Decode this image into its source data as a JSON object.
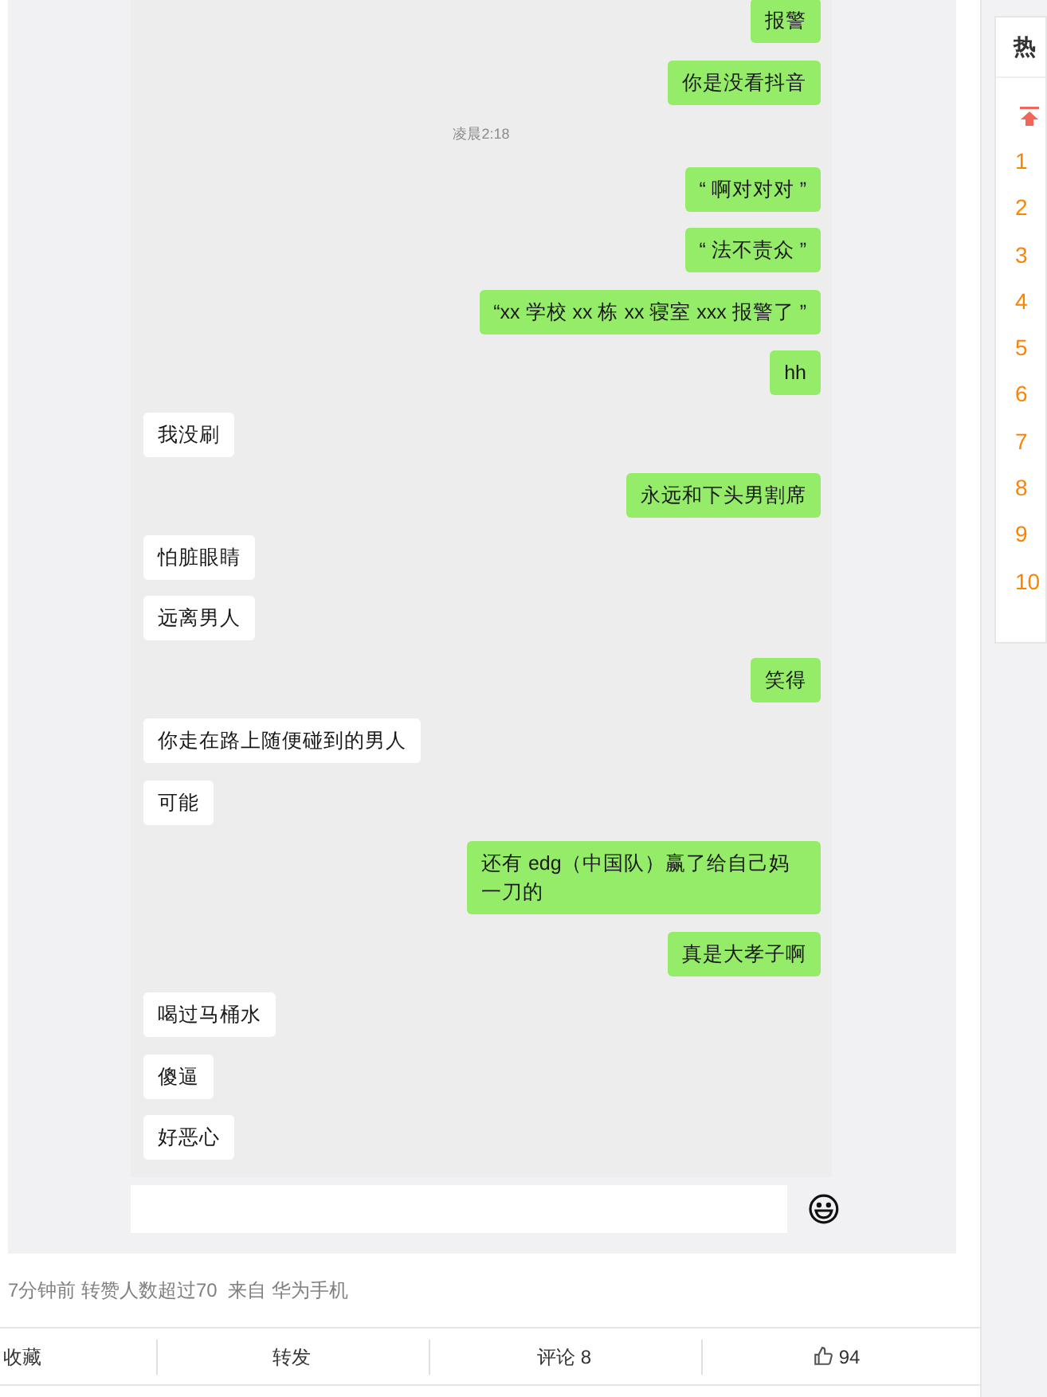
{
  "chat": {
    "messages": [
      {
        "kind": "sent",
        "text": "报警"
      },
      {
        "kind": "sent",
        "text": "你是没看抖音"
      },
      {
        "kind": "time",
        "text": "凌晨2:18"
      },
      {
        "kind": "sent",
        "text": "“ 啊对对对 ”"
      },
      {
        "kind": "sent",
        "text": "“ 法不责众 ”"
      },
      {
        "kind": "sent",
        "text": "“xx 学校 xx 栋 xx 寝室 xxx 报警了 ”"
      },
      {
        "kind": "sent",
        "text": "hh"
      },
      {
        "kind": "received",
        "text": "我没刷"
      },
      {
        "kind": "sent",
        "text": "永远和下头男割席"
      },
      {
        "kind": "received",
        "text": "怕脏眼睛"
      },
      {
        "kind": "received",
        "text": "远离男人"
      },
      {
        "kind": "sent",
        "text": "笑得"
      },
      {
        "kind": "received",
        "text": "你走在路上随便碰到的男人"
      },
      {
        "kind": "received",
        "text": "可能"
      },
      {
        "kind": "sent",
        "text": "还有 edg（中国队）赢了给自己妈一刀的"
      },
      {
        "kind": "sent",
        "text": "真是大孝子啊"
      },
      {
        "kind": "received",
        "text": "喝过马桶水"
      },
      {
        "kind": "received",
        "text": "傻逼"
      },
      {
        "kind": "received",
        "text": "好恶心"
      }
    ]
  },
  "post_meta": "7分钟前 转赞人数超过70  来自 华为手机",
  "actions": [
    {
      "kind": "text",
      "label": "收藏"
    },
    {
      "kind": "text",
      "label": "转发"
    },
    {
      "kind": "text",
      "label": "评论 8"
    },
    {
      "kind": "like",
      "label": "94"
    }
  ],
  "sidebar": {
    "title": "热",
    "ranks": [
      "1",
      "2",
      "3",
      "4",
      "5",
      "6",
      "7",
      "8",
      "9",
      "10"
    ]
  }
}
